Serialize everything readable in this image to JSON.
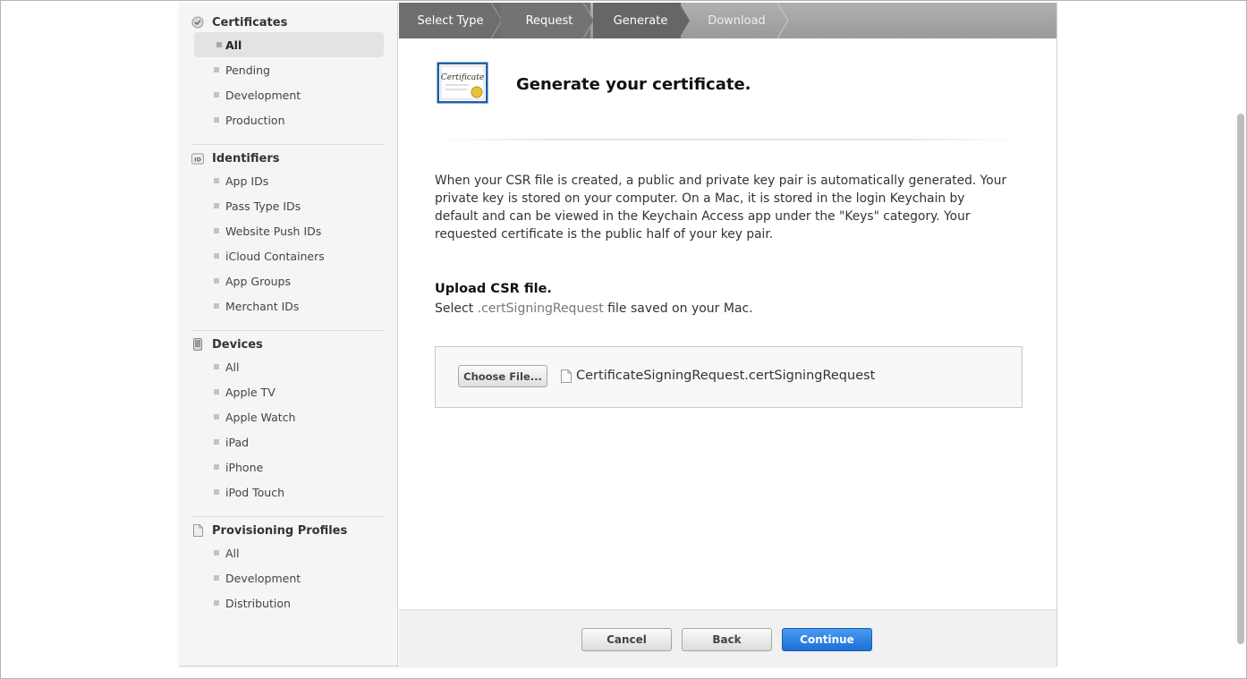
{
  "sidebar": {
    "certificates": {
      "heading": "Certificates",
      "icon": "certificate-seal-icon",
      "items": [
        "All",
        "Pending",
        "Development",
        "Production"
      ],
      "active": "All"
    },
    "identifiers": {
      "heading": "Identifiers",
      "icon": "id-badge-icon",
      "icon_text": "ID",
      "items": [
        "App IDs",
        "Pass Type IDs",
        "Website Push IDs",
        "iCloud Containers",
        "App Groups",
        "Merchant IDs"
      ]
    },
    "devices": {
      "heading": "Devices",
      "icon": "phone-device-icon",
      "items": [
        "All",
        "Apple TV",
        "Apple Watch",
        "iPad",
        "iPhone",
        "iPod Touch"
      ]
    },
    "profiles": {
      "heading": "Provisioning Profiles",
      "icon": "document-icon",
      "items": [
        "All",
        "Development",
        "Distribution"
      ]
    }
  },
  "breadcrumb": {
    "steps": [
      "Select Type",
      "Request",
      "Generate",
      "Download"
    ],
    "current": "Generate"
  },
  "main": {
    "title": "Generate your certificate.",
    "cert_icon_text": "Certificate",
    "description": "When your CSR file is created, a public and private key pair is automatically generated. Your private key is stored on your computer. On a Mac, it is stored in the login Keychain by default and can be viewed in the Keychain Access app under the \"Keys\" category. Your requested certificate is the public half of your key pair.",
    "upload_title": "Upload CSR file.",
    "upload_desc_prefix": "Select",
    "upload_desc_ext": ".certSigningRequest",
    "upload_desc_suffix": "file saved on your Mac.",
    "choose_file_label": "Choose File...",
    "selected_file": "CertificateSigningRequest.certSigningRequest"
  },
  "footer": {
    "cancel": "Cancel",
    "back": "Back",
    "continue": "Continue"
  },
  "colors": {
    "accent": "#1c6fd6",
    "crumb_active": "#6b6b6b",
    "crumb_done": "#8a8a8a"
  }
}
